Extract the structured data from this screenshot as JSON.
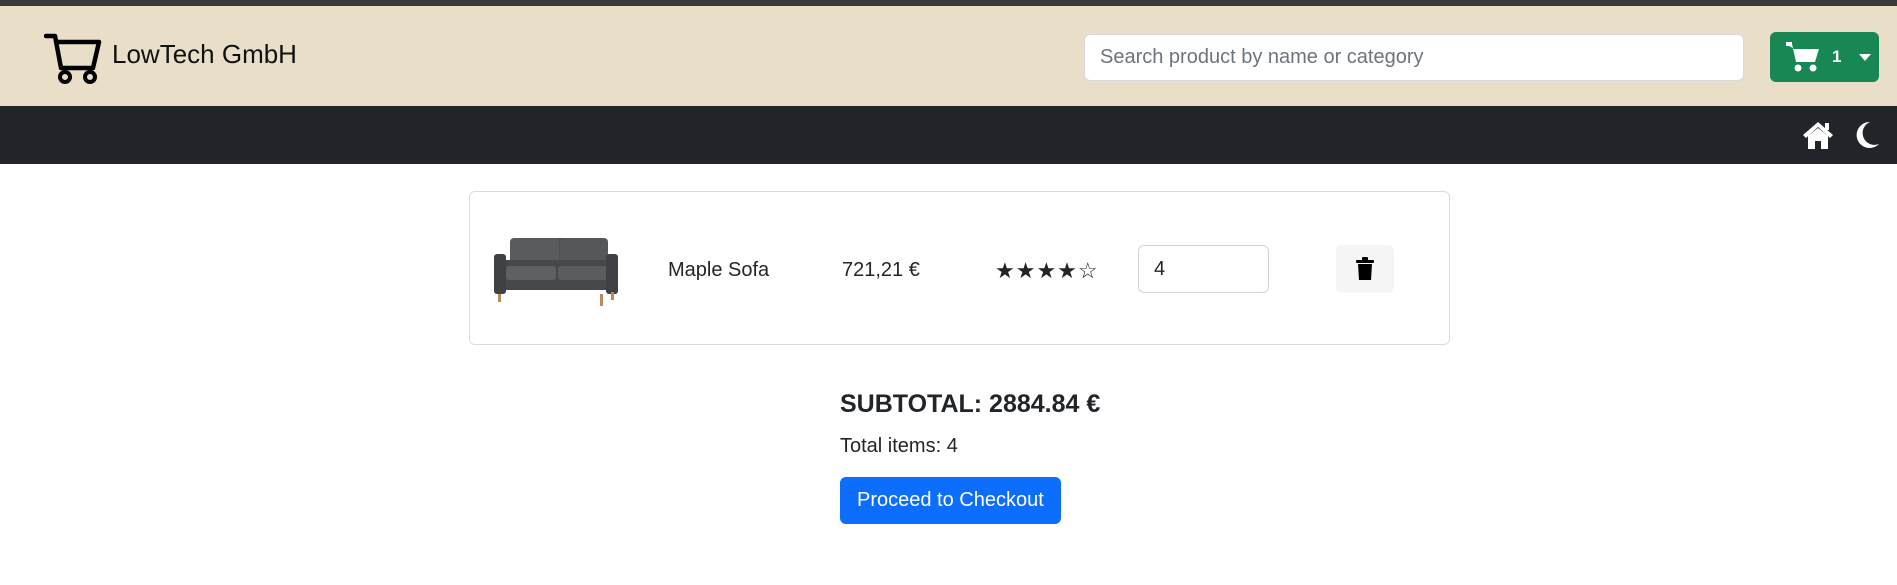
{
  "header": {
    "brand_name": "LowTech GmbH",
    "logo_icon": "shopping-cart-icon",
    "search_placeholder": "Search product by name or category",
    "cart_count": "1",
    "cart_button_color": "#198754"
  },
  "navbar": {
    "icons": [
      "home-icon",
      "moon-icon"
    ]
  },
  "cart": {
    "items": [
      {
        "name": "Maple Sofa",
        "price": "721,21 €",
        "rating_stars": 4,
        "rating_max": 5,
        "stars_text": "★★★★☆",
        "quantity": "4",
        "image": "sofa-image"
      }
    ]
  },
  "summary": {
    "subtotal": "SUBTOTAL: 2884.84 €",
    "total_items": "Total items: 4",
    "checkout_label": "Proceed to Checkout",
    "checkout_color": "#0d6efd"
  }
}
